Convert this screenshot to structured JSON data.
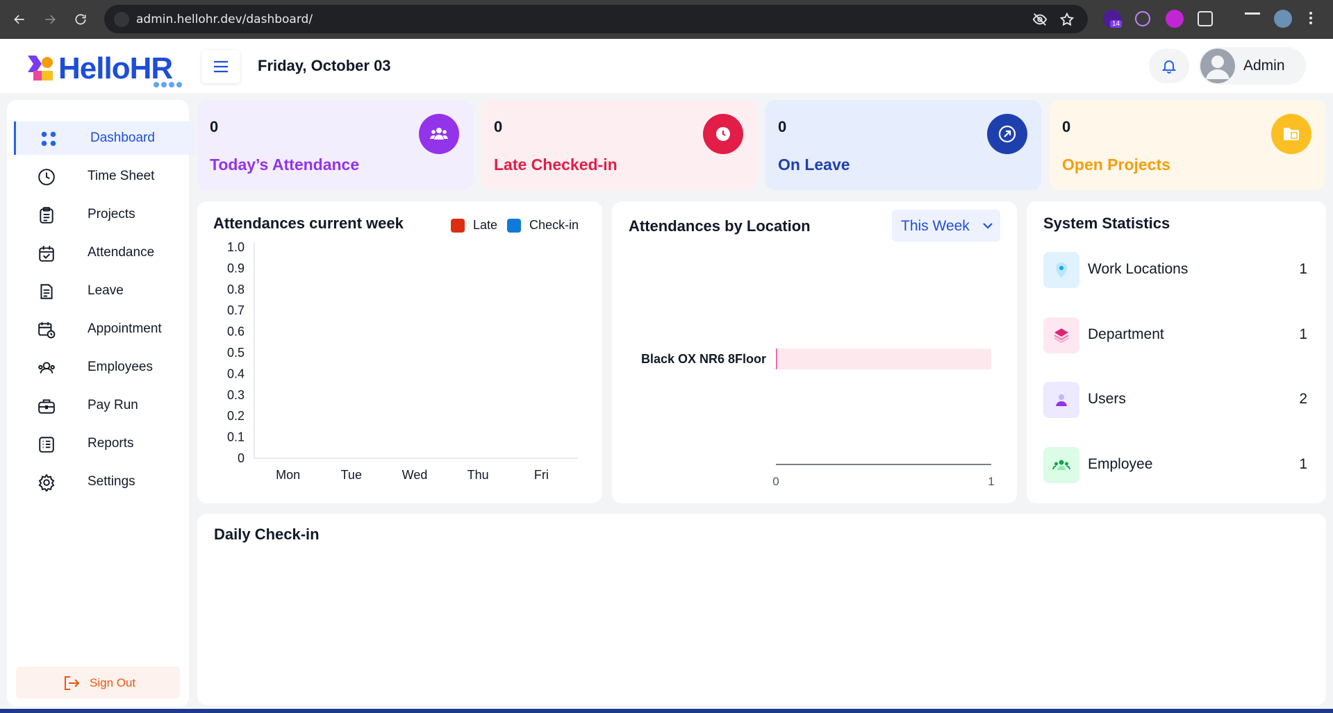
{
  "browser": {
    "url": "admin.hellohr.dev/dashboard/",
    "extension_badge": "14"
  },
  "header": {
    "brand": "HelloHR",
    "date": "Friday, October 03",
    "user_name": "Admin"
  },
  "sidebar": {
    "items": [
      {
        "label": "Dashboard",
        "icon": "grid-icon",
        "active": true
      },
      {
        "label": "Time Sheet",
        "icon": "clock-icon"
      },
      {
        "label": "Projects",
        "icon": "clipboard-icon"
      },
      {
        "label": "Attendance",
        "icon": "calendar-check-icon"
      },
      {
        "label": "Leave",
        "icon": "document-icon"
      },
      {
        "label": "Appointment",
        "icon": "calendar-clock-icon"
      },
      {
        "label": "Employees",
        "icon": "people-icon"
      },
      {
        "label": "Pay Run",
        "icon": "briefcase-icon"
      },
      {
        "label": "Reports",
        "icon": "list-icon"
      },
      {
        "label": "Settings",
        "icon": "gear-icon"
      }
    ],
    "sign_out": "Sign Out"
  },
  "cards": [
    {
      "value": "0",
      "title": "Today’s Attendance",
      "bg": "#f3eefe",
      "color": "#9333ea",
      "badge": "#9333ea",
      "icon": "users-icon"
    },
    {
      "value": "0",
      "title": "Late Checked-in",
      "bg": "#fdeef1",
      "color": "#e11d48",
      "badge": "#e11d48",
      "icon": "clock-icon"
    },
    {
      "value": "0",
      "title": "On Leave",
      "bg": "#e6edfc",
      "color": "#1e40af",
      "badge": "#1e40af",
      "icon": "arrow-up-right-icon"
    },
    {
      "value": "0",
      "title": "Open Projects",
      "bg": "#fef7ea",
      "color": "#f59e0b",
      "badge": "#fbbf24",
      "icon": "folder-icon"
    }
  ],
  "attendance_panel": {
    "title": "Attendances current week",
    "legend": [
      {
        "name": "Late",
        "color": "#dc2f12"
      },
      {
        "name": "Check-in",
        "color": "#0f7ad8"
      }
    ]
  },
  "location_panel": {
    "title": "Attendances by Location",
    "filter": "This Week"
  },
  "system_panel": {
    "title": "System Statistics",
    "rows": [
      {
        "label": "Work Locations",
        "value": "1",
        "icon": "map-pin-icon",
        "bg": "#e0f2fe",
        "color": "#0ea5e9"
      },
      {
        "label": "Department",
        "value": "1",
        "icon": "layers-icon",
        "bg": "#fde8f1",
        "color": "#db2777"
      },
      {
        "label": "Users",
        "value": "2",
        "icon": "user-icon",
        "bg": "#ede9fe",
        "color": "#9333ea"
      },
      {
        "label": "Employee",
        "value": "1",
        "icon": "team-icon",
        "bg": "#dcfce7",
        "color": "#16a34a"
      }
    ]
  },
  "daily_panel": {
    "title": "Daily Check-in"
  },
  "chart_data": [
    {
      "type": "bar",
      "title": "Attendances current week",
      "categories": [
        "Mon",
        "Tue",
        "Wed",
        "Thu",
        "Fri"
      ],
      "series": [
        {
          "name": "Late",
          "values": [
            0,
            0,
            0,
            0,
            0
          ]
        },
        {
          "name": "Check-in",
          "values": [
            0,
            0,
            0,
            0,
            0
          ]
        }
      ],
      "yticks": [
        "0",
        "0.1",
        "0.2",
        "0.3",
        "0.4",
        "0.5",
        "0.6",
        "0.7",
        "0.8",
        "0.9",
        "1.0"
      ],
      "ylim": [
        0,
        1
      ],
      "legend": "top-right"
    },
    {
      "type": "bar",
      "orientation": "horizontal",
      "title": "Attendances by Location",
      "categories": [
        "Black OX NR6 8Floor"
      ],
      "values": [
        0
      ],
      "xticks": [
        "0",
        "1"
      ],
      "xlim": [
        0,
        1
      ]
    }
  ]
}
